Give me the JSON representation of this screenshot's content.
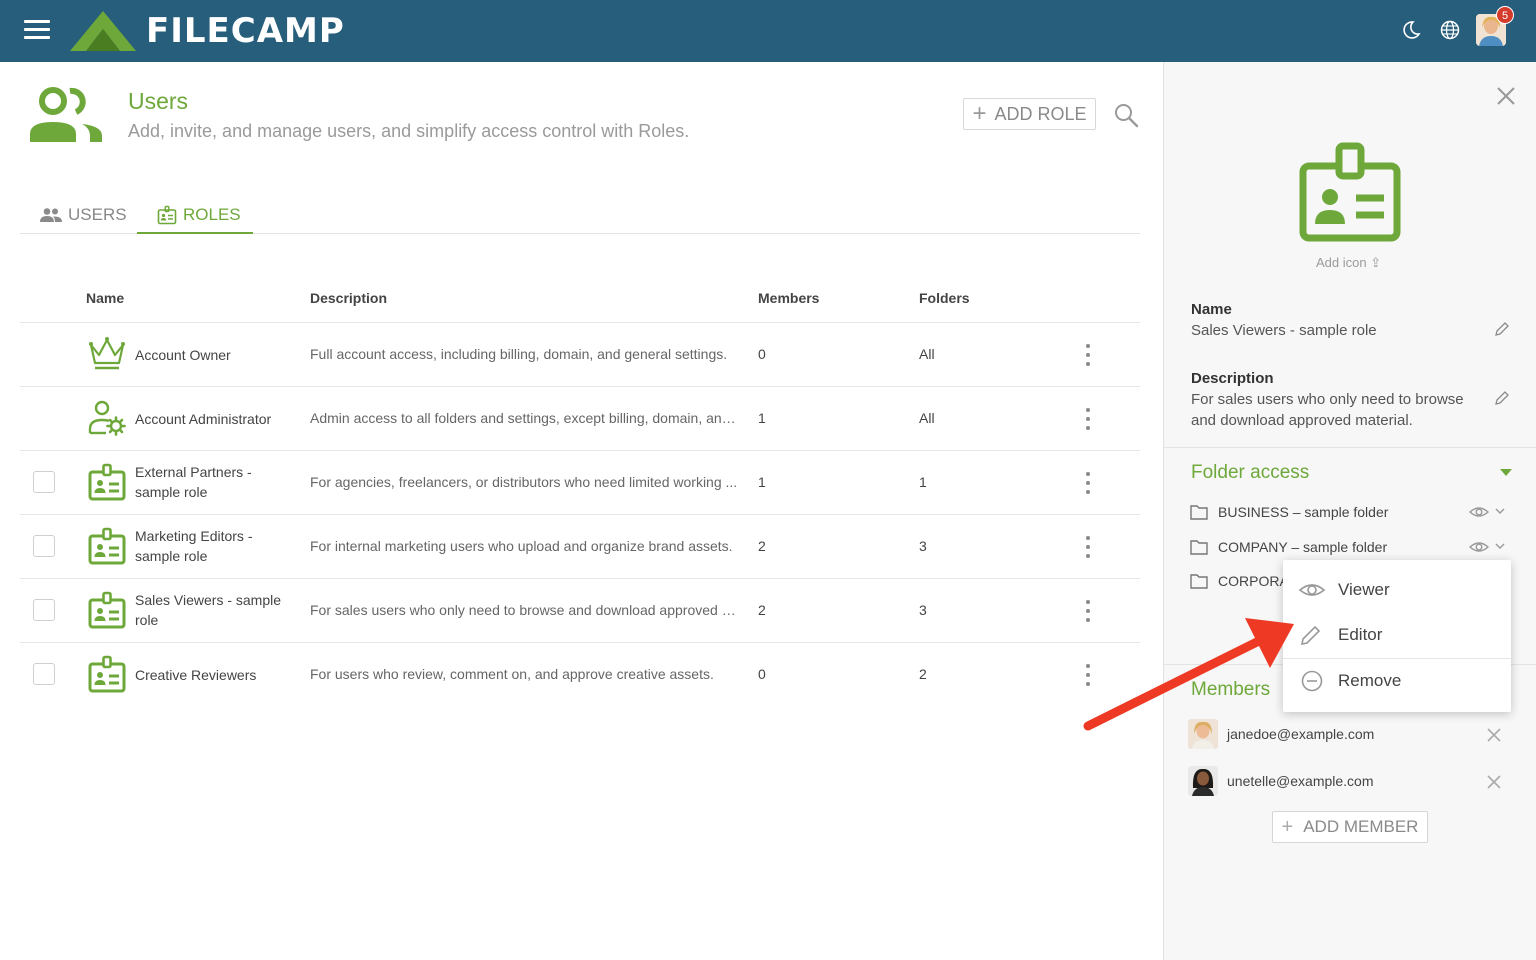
{
  "header": {
    "logo_text": "FILECAMP",
    "notification_count": "5"
  },
  "page": {
    "title": "Users",
    "subtitle": "Add, invite, and manage users, and simplify access control with Roles.",
    "add_role_label": "ADD ROLE"
  },
  "tabs": [
    {
      "label": "USERS",
      "active": false
    },
    {
      "label": "ROLES",
      "active": true
    }
  ],
  "table": {
    "columns": [
      "Name",
      "Description",
      "Members",
      "Folders"
    ],
    "rows": [
      {
        "name": "Account Owner",
        "description": "Full account access, including billing, domain, and general settings.",
        "members": "0",
        "folders": "All",
        "icon": "crown-icon"
      },
      {
        "name": "Account Administrator",
        "description": "Admin access to all folders and settings, except billing, domain, and...",
        "members": "1",
        "folders": "All",
        "icon": "user-gear-icon"
      },
      {
        "name": "External Partners - sample role",
        "description": "For agencies, freelancers, or distributors who need limited working ...",
        "members": "1",
        "folders": "1",
        "icon": "id-badge-icon"
      },
      {
        "name": "Marketing Editors - sample role",
        "description": "For internal marketing users who upload and organize brand assets.",
        "members": "2",
        "folders": "3",
        "icon": "id-badge-icon"
      },
      {
        "name": "Sales Viewers - sample role",
        "description": "For sales users who only need to browse and download approved m...",
        "members": "2",
        "folders": "3",
        "icon": "id-badge-icon"
      },
      {
        "name": "Creative Reviewers",
        "description": "For users who review, comment on, and approve creative assets.",
        "members": "0",
        "folders": "2",
        "icon": "id-badge-icon"
      }
    ]
  },
  "panel": {
    "add_icon_label": "Add icon",
    "name_label": "Name",
    "name_value": "Sales Viewers - sample role",
    "description_label": "Description",
    "description_value": "For sales users who only need to browse and download approved material.",
    "folder_access_title": "Folder access",
    "folders": [
      {
        "name": "BUSINESS – sample folder"
      },
      {
        "name": "COMPANY – sample folder"
      },
      {
        "name": "CORPORA"
      }
    ],
    "menu": [
      {
        "label": "Viewer",
        "icon": "eye-icon"
      },
      {
        "label": "Editor",
        "icon": "pencil-icon"
      },
      {
        "label": "Remove",
        "icon": "minus-circle-icon"
      }
    ],
    "members_title": "Members",
    "members": [
      {
        "email": "janedoe@example.com"
      },
      {
        "email": "unetelle@example.com"
      }
    ],
    "add_member_label": "ADD MEMBER"
  },
  "colors": {
    "topbar": "#275e7b",
    "accent_green": "#6ea83a",
    "badge_red": "#d33b2c",
    "annotation_arrow": "#ee3a24"
  }
}
